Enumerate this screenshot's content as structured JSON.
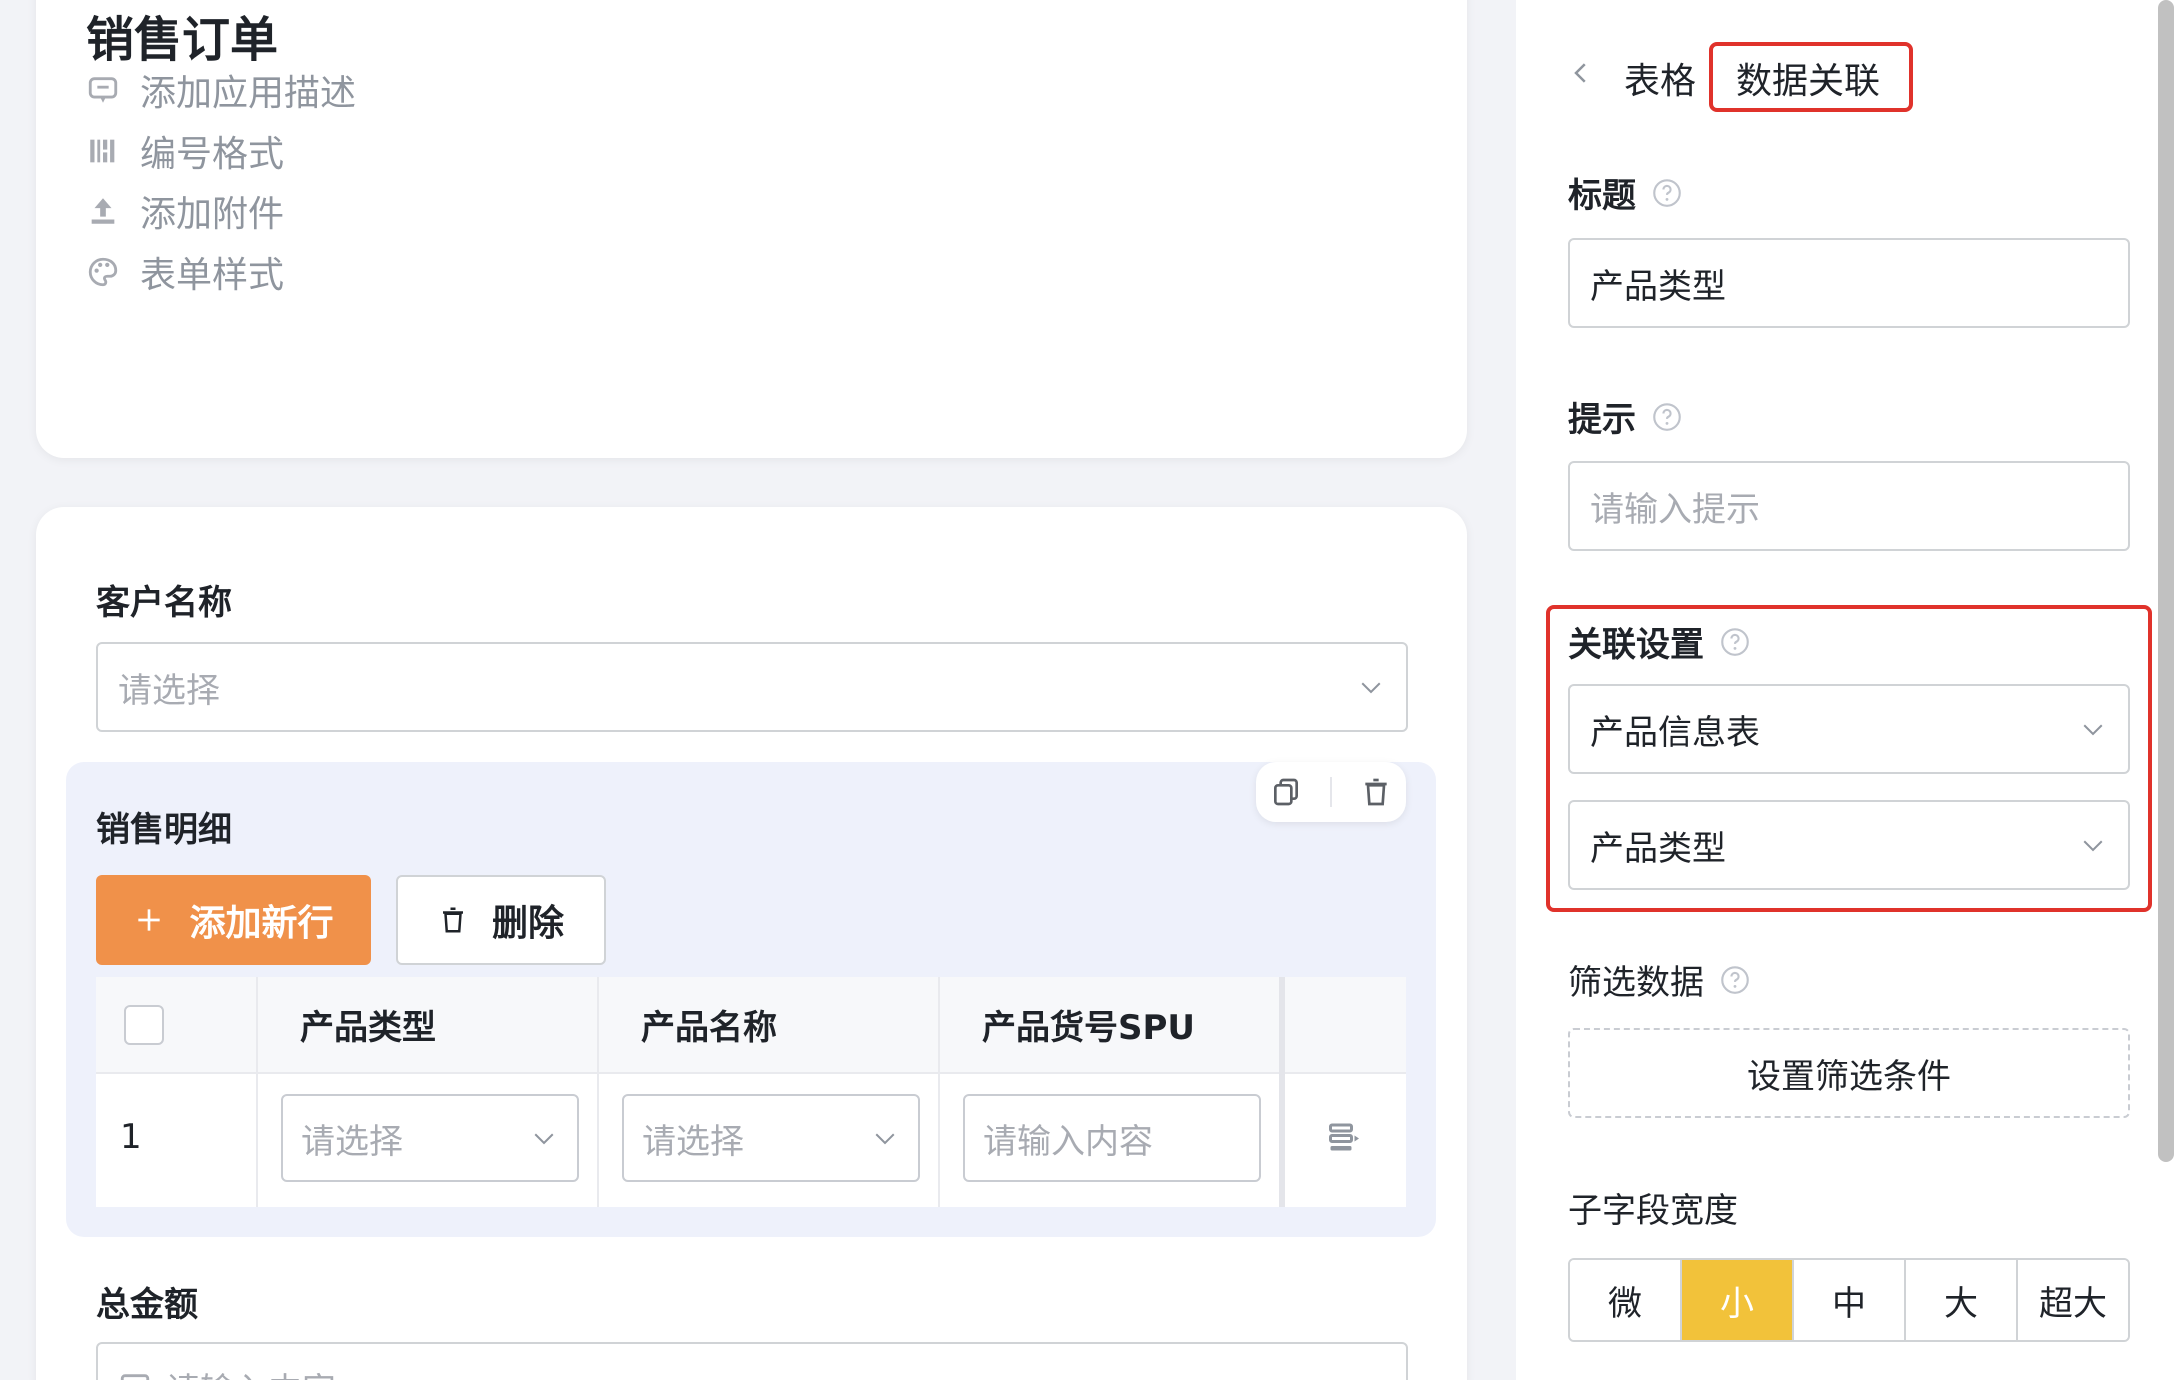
{
  "form": {
    "title": "销售订单",
    "options": [
      {
        "label": "添加应用描述",
        "icon": "comment-icon"
      },
      {
        "label": "编号格式",
        "icon": "barcode-icon"
      },
      {
        "label": "添加附件",
        "icon": "upload-icon"
      },
      {
        "label": "表单样式",
        "icon": "palette-icon"
      }
    ],
    "customer": {
      "label": "客户名称",
      "placeholder": "请选择"
    },
    "detail": {
      "label": "销售明细",
      "add_button": "添加新行",
      "delete_button": "删除",
      "columns": [
        "产品类型",
        "产品名称",
        "产品货号SPU"
      ],
      "rows": [
        {
          "index": "1",
          "type_placeholder": "请选择",
          "name_placeholder": "请选择",
          "spu_placeholder": "请输入内容"
        }
      ]
    },
    "total": {
      "label": "总金额",
      "placeholder": "请输入内容"
    }
  },
  "panel": {
    "breadcrumb_parent": "表格",
    "breadcrumb_current": "数据关联",
    "title_label": "标题",
    "title_value": "产品类型",
    "hint_label": "提示",
    "hint_placeholder": "请输入提示",
    "relation_label": "关联设置",
    "relation_table": "产品信息表",
    "relation_field": "产品类型",
    "filter_label": "筛选数据",
    "filter_button": "设置筛选条件",
    "width_label": "子字段宽度",
    "width_options": [
      "微",
      "小",
      "中",
      "大",
      "超大"
    ],
    "width_selected": "小"
  },
  "colors": {
    "primary_button": "#f0914a",
    "selected_segment": "#f2c23a",
    "highlight_border": "#e0322b"
  }
}
